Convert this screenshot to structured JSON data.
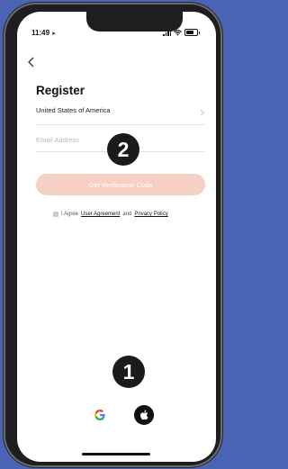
{
  "status_bar": {
    "time": "11:49",
    "location_glyph": "➤"
  },
  "header": {
    "title": "Register"
  },
  "form": {
    "country_value": "United States of America",
    "email_placeholder": "Email Address",
    "email_value": "",
    "get_code_label": "Get Verification Code"
  },
  "agreement": {
    "prefix": "I Agree",
    "user_agreement": "User Agreement",
    "and": "and",
    "privacy_policy": "Privacy Policy"
  },
  "annotations": {
    "badge_2": "2",
    "badge_1": "1"
  },
  "social_login": {
    "google_icon": "google-icon",
    "apple_icon": "apple-icon"
  },
  "colors": {
    "background": "#4a63b4",
    "button_disabled": "#f6cfc5",
    "badge": "#1b1b1b"
  }
}
